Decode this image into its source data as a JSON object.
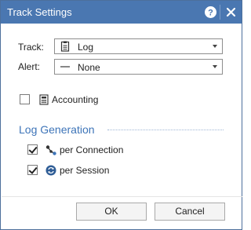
{
  "dialog": {
    "title": "Track Settings",
    "help_icon": "help-icon",
    "close_icon": "close-icon"
  },
  "track": {
    "label": "Track:",
    "value": "Log",
    "icon": "log-document-icon"
  },
  "alert": {
    "label": "Alert:",
    "value": "None",
    "icon": "none-dash-icon"
  },
  "accounting": {
    "label": "Accounting",
    "checked": false,
    "icon": "accounting-calculator-icon"
  },
  "log_generation": {
    "title": "Log Generation",
    "per_connection": {
      "label": "per Connection",
      "checked": true,
      "icon": "connection-nodes-icon"
    },
    "per_session": {
      "label": "per Session",
      "checked": true,
      "icon": "session-cycle-icon"
    }
  },
  "buttons": {
    "ok": "OK",
    "cancel": "Cancel"
  },
  "colors": {
    "titlebar": "#4a77b1",
    "accent": "#3d74b8"
  }
}
